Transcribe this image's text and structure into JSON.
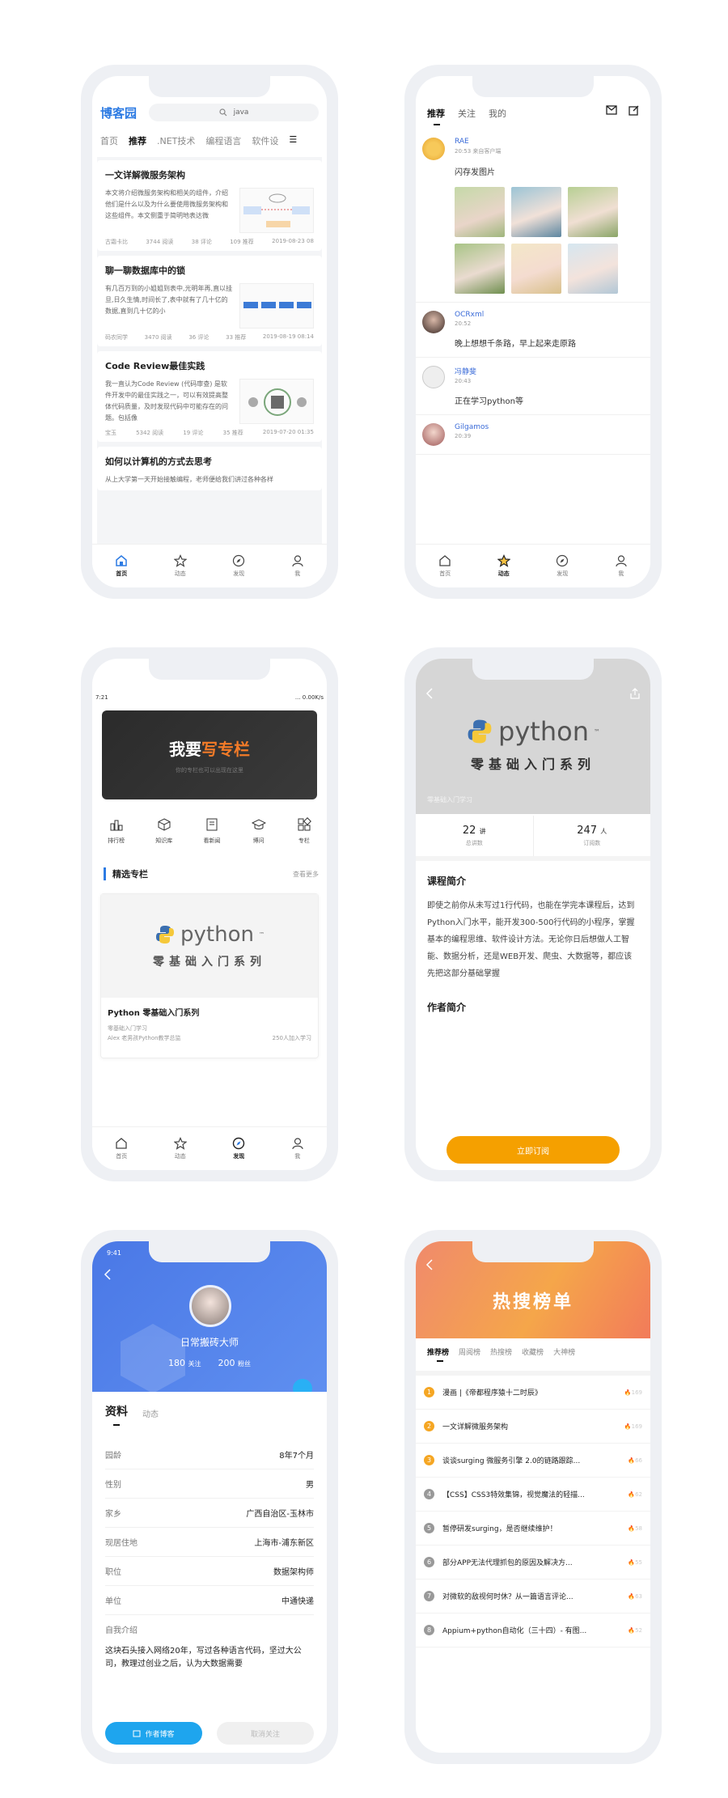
{
  "colors": {
    "brand_blue": "#2d7be3",
    "accent_orange": "#f5a000",
    "rank_hot": "#f5a623",
    "rank_normal": "#999999",
    "profile_blue": "#4a78e6"
  },
  "phone1": {
    "logo": "博客园",
    "search_query": "java",
    "categories": [
      "首页",
      "推荐",
      ".NET技术",
      "编程语言",
      "软件设"
    ],
    "articles": [
      {
        "title": "一文详解微服务架构",
        "summary": "本文将介绍微服务架构和相关的组件，介绍他们是什么以及为什么要使用微服务架构和这些组件。本文侧重于简明地表达微",
        "author": "古霜卡比",
        "reads": "3744 阅读",
        "comments": "38 评论",
        "recs": "109 推荐",
        "date": "2019-08-23 08"
      },
      {
        "title": "聊一聊数据库中的锁",
        "summary": "有几百万到的小姐姐到表中,光明年再,直以挂旦,日久生情,时间长了,表中就有了几十亿的 数据,直到几十亿的小",
        "author": "码农同学",
        "reads": "3470 阅读",
        "comments": "36 评论",
        "recs": "33 推荐",
        "date": "2019-08-19 08:14"
      },
      {
        "title": "Code Review最佳实践",
        "summary": "我一直认为Code Review (代码审查) 是软件开发中的最佳实践之一，可以有效提高整体代码质量，及时发现代码中可能存在的问题。包括像",
        "author": "宝玉",
        "reads": "5342 阅读",
        "comments": "19 评论",
        "recs": "35 推荐",
        "date": "2019-07-20 01:35"
      },
      {
        "title": "如何以计算机的方式去思考",
        "summary": "从上大学第一天开始接触编程，老师便给我们讲过各种各样"
      }
    ],
    "tabs": [
      "首页",
      "动态",
      "发现",
      "我"
    ]
  },
  "phone2": {
    "tabs": [
      "推荐",
      "关注",
      "我的"
    ],
    "posts": [
      {
        "name": "RAE",
        "time": "20:53  来自客户端",
        "content": "闪存发图片"
      },
      {
        "name": "OCRxml",
        "time": "20:52",
        "content": "晚上想想千条路，早上起来走原路"
      },
      {
        "name": "冯静斐",
        "time": "20:43",
        "content": "正在学习python等"
      },
      {
        "name": "Gilgamos",
        "time": "20:39",
        "content": ""
      }
    ],
    "tabs_bottom": [
      "首页",
      "动态",
      "发现",
      "我"
    ]
  },
  "phone3": {
    "status_time": "7:21",
    "status_right": "... 0.00K/s",
    "banner_title_a": "我要",
    "banner_title_b": "写专栏",
    "banner_sub": "你的专栏也可以出现在这里",
    "menu": [
      "排行榜",
      "知识库",
      "看新闻",
      "博问",
      "专栏"
    ],
    "section_title": "精选专栏",
    "section_more": "查看更多",
    "card": {
      "logo_word": "python",
      "logo_tm": "™",
      "cover_sub": "零基础入门系列",
      "title": "Python 零基础入门系列",
      "subtitle": "零基础入门学习",
      "author": "Alex 老男孩Python教学总监",
      "joined": "250人加入学习"
    },
    "tabs": [
      "首页",
      "动态",
      "发现",
      "我"
    ]
  },
  "phone4": {
    "logo_word": "python",
    "logo_tm": "™",
    "cover_sub": "零基础入门系列",
    "caption": "零基础入门学习",
    "lessons_value": "22",
    "lessons_unit": "讲",
    "lessons_label": "总讲数",
    "subs_value": "247",
    "subs_unit": "人",
    "subs_label": "订阅数",
    "intro_title": "课程简介",
    "intro_text": "即使之前你从未写过1行代码，也能在学完本课程后，达到Python入门水平，能开发300-500行代码的小程序，掌握基本的编程思维、软件设计方法。无论你日后想做人工智能、数据分析，还是WEB开发、爬虫、大数据等，都应该先把这部分基础掌握",
    "author_title": "作者简介",
    "button": "立即订阅"
  },
  "phone5": {
    "status_time": "9:41",
    "name": "日常搬砖大师",
    "follow_value": "180",
    "follow_label": "关注",
    "fans_value": "200",
    "fans_label": "粉丝",
    "tab_profile": "资料",
    "tab_activity": "动态",
    "rows": [
      {
        "k": "园龄",
        "v": "8年7个月"
      },
      {
        "k": "性别",
        "v": "男"
      },
      {
        "k": "家乡",
        "v": "广西自治区-玉林市"
      },
      {
        "k": "现居住地",
        "v": "上海市-浦东新区"
      },
      {
        "k": "职位",
        "v": "数据架构师"
      },
      {
        "k": "单位",
        "v": "中通快递"
      }
    ],
    "intro_label": "自我介绍",
    "intro_text": "这块石头接入网络20年，写过各种语言代码，坚过大公司，教理过创业之后，认为大数据需要",
    "btn_blog": "作者博客",
    "btn_unfollow": "取消关注"
  },
  "phone6": {
    "title": "热搜榜单",
    "tabs": [
      "推荐榜",
      "周阅榜",
      "热搜榜",
      "收藏榜",
      "大神榜"
    ],
    "items": [
      {
        "n": "1",
        "t": "漫画 |《帝都程序猿十二时辰》",
        "h": "169"
      },
      {
        "n": "2",
        "t": "一文详解微服务架构",
        "h": "169"
      },
      {
        "n": "3",
        "t": "谈谈surging 微服务引擎 2.0的链路跟踪...",
        "h": "66"
      },
      {
        "n": "4",
        "t": "【CSS】CSS3特效集锦，视觉魔法的轻描...",
        "h": "62"
      },
      {
        "n": "5",
        "t": "暂停研发surging，是否继续维护！",
        "h": "58"
      },
      {
        "n": "6",
        "t": "部分APP无法代理抓包的原因及解决方...",
        "h": "55"
      },
      {
        "n": "7",
        "t": "对微软的敌视何时休？从一篇语言评论...",
        "h": "63"
      },
      {
        "n": "8",
        "t": "Appium+python自动化（三十四）- 有图...",
        "h": "52"
      }
    ]
  }
}
